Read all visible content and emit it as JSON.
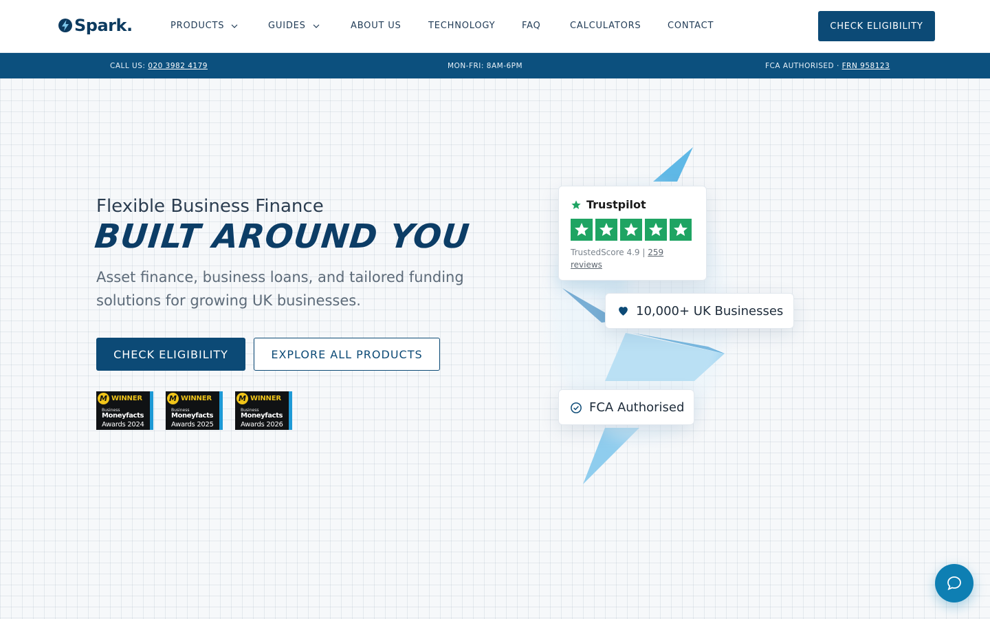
{
  "brand": {
    "name": "Spark.",
    "accent": "#0c4a76",
    "light_blue": "#7cc6ea",
    "trustpilot_green": "#1fa463"
  },
  "nav": {
    "items": [
      {
        "label": "PRODUCTS",
        "has_dropdown": true
      },
      {
        "label": "GUIDES",
        "has_dropdown": true
      },
      {
        "label": "ABOUT US",
        "has_dropdown": false
      },
      {
        "label": "TECHNOLOGY",
        "has_dropdown": false
      },
      {
        "label": "FAQ",
        "has_dropdown": false
      },
      {
        "label": "CALCULATORS",
        "has_dropdown": false
      },
      {
        "label": "CONTACT",
        "has_dropdown": false
      }
    ],
    "cta_label": "CHECK ELIGIBILITY"
  },
  "infobar": {
    "call_label": "CALL US:",
    "phone": "020 3982 4179",
    "hours": "MON-FRI: 8AM-6PM",
    "fca_label": "FCA AUTHORISED ·",
    "frn": "FRN 958123"
  },
  "hero": {
    "eyebrow": "Flexible Business Finance",
    "headline": "BUILT AROUND YOU",
    "subtitle": "Asset finance, business loans, and tailored funding solutions for growing UK businesses.",
    "primary_cta": "CHECK ELIGIBILITY",
    "secondary_cta": "EXPLORE ALL PRODUCTS"
  },
  "awards": [
    {
      "badge": "WINNER",
      "line1": "Business",
      "line2": "Moneyfacts",
      "line3": "Awards 2024"
    },
    {
      "badge": "WINNER",
      "line1": "Business",
      "line2": "Moneyfacts",
      "line3": "Awards 2025"
    },
    {
      "badge": "WINNER",
      "line1": "Business",
      "line2": "Moneyfacts",
      "line3": "Awards 2026"
    }
  ],
  "trustpilot": {
    "name": "Trustpilot",
    "rating_stars": 5,
    "score_text": "TrustedScore 4.9 |",
    "reviews_link": "259 reviews"
  },
  "stat_card": {
    "text": "10,000+ UK Businesses",
    "icon": "heart-icon"
  },
  "fca_card": {
    "text": "FCA Authorised",
    "icon": "check-circle-icon"
  },
  "chat": {
    "icon": "chat-bubble-icon"
  }
}
